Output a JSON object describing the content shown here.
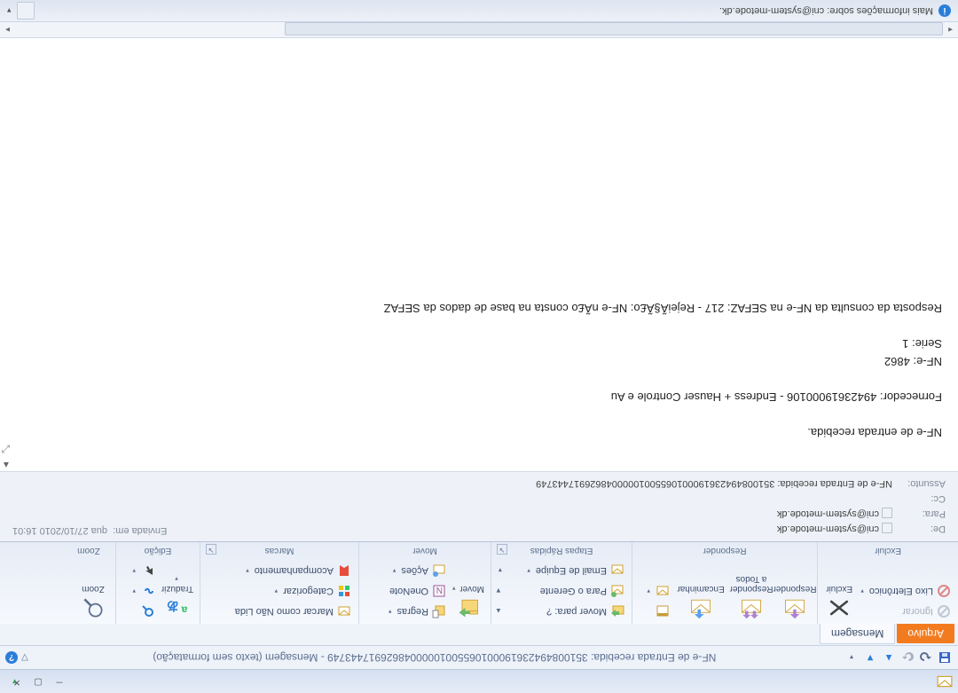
{
  "window": {
    "title_qat": "NF-e de Entrada recebida: 35100849423619000106550010000048626917443749  -  Mensagem (texto sem formatação)"
  },
  "tabs": {
    "file": "Arquivo",
    "message": "Mensagem"
  },
  "ribbon": {
    "excluir": {
      "label": "Excluir",
      "ignore": "Ignorar",
      "junk": "Lixo Eletrônico",
      "delete": "Excluir"
    },
    "responder": {
      "label": "Responder",
      "reply": "Responder",
      "reply_all": "Responder a Todos",
      "forward": "Encaminhar"
    },
    "etapas": {
      "label": "Etapas Rápidas",
      "move_to": "Mover para: ?",
      "to_manager": "Para o Gerente",
      "team_email": "Email de Equipe"
    },
    "mover": {
      "label": "Mover",
      "move": "Mover",
      "rules": "Regras",
      "onenote": "OneNote",
      "actions": "Ações"
    },
    "marcas": {
      "label": "Marcas",
      "unread": "Marcar como Não Lida",
      "categorize": "Categorizar",
      "followup": "Acompanhamento"
    },
    "edicao": {
      "label": "Edição",
      "translate": "Traduzir"
    },
    "zoom": {
      "label": "Zoom",
      "zoom": "Zoom"
    }
  },
  "header": {
    "from_lbl": "De:",
    "from": "cni@system-metode.dk",
    "to_lbl": "Para:",
    "to": "cni@system-metode.dk",
    "cc_lbl": "Cc:",
    "cc": "",
    "subject_lbl": "Assunto:",
    "subject": "NF-e de Entrada recebida: 35100849423619000106550010000048626917443749",
    "sent_lbl": "Enviada em:",
    "sent": "qua 27/10/2010 16:01"
  },
  "body": {
    "l1": "NF-e de entrada recebida.",
    "l2": "Fornecedor: 49423619000106 - Endress + Hauser Controle e Au",
    "l3": "NF-e: 4862",
    "l4": "Serie: 1",
    "l5": "Resposta da consulta da NF-e na SEFAZ: 217 - RejeiÃ§Ã£o: NF-e nÃ£o consta na base de dados da SEFAZ"
  },
  "status": {
    "text": "Mais informações sobre: cni@system-metode.dk."
  }
}
